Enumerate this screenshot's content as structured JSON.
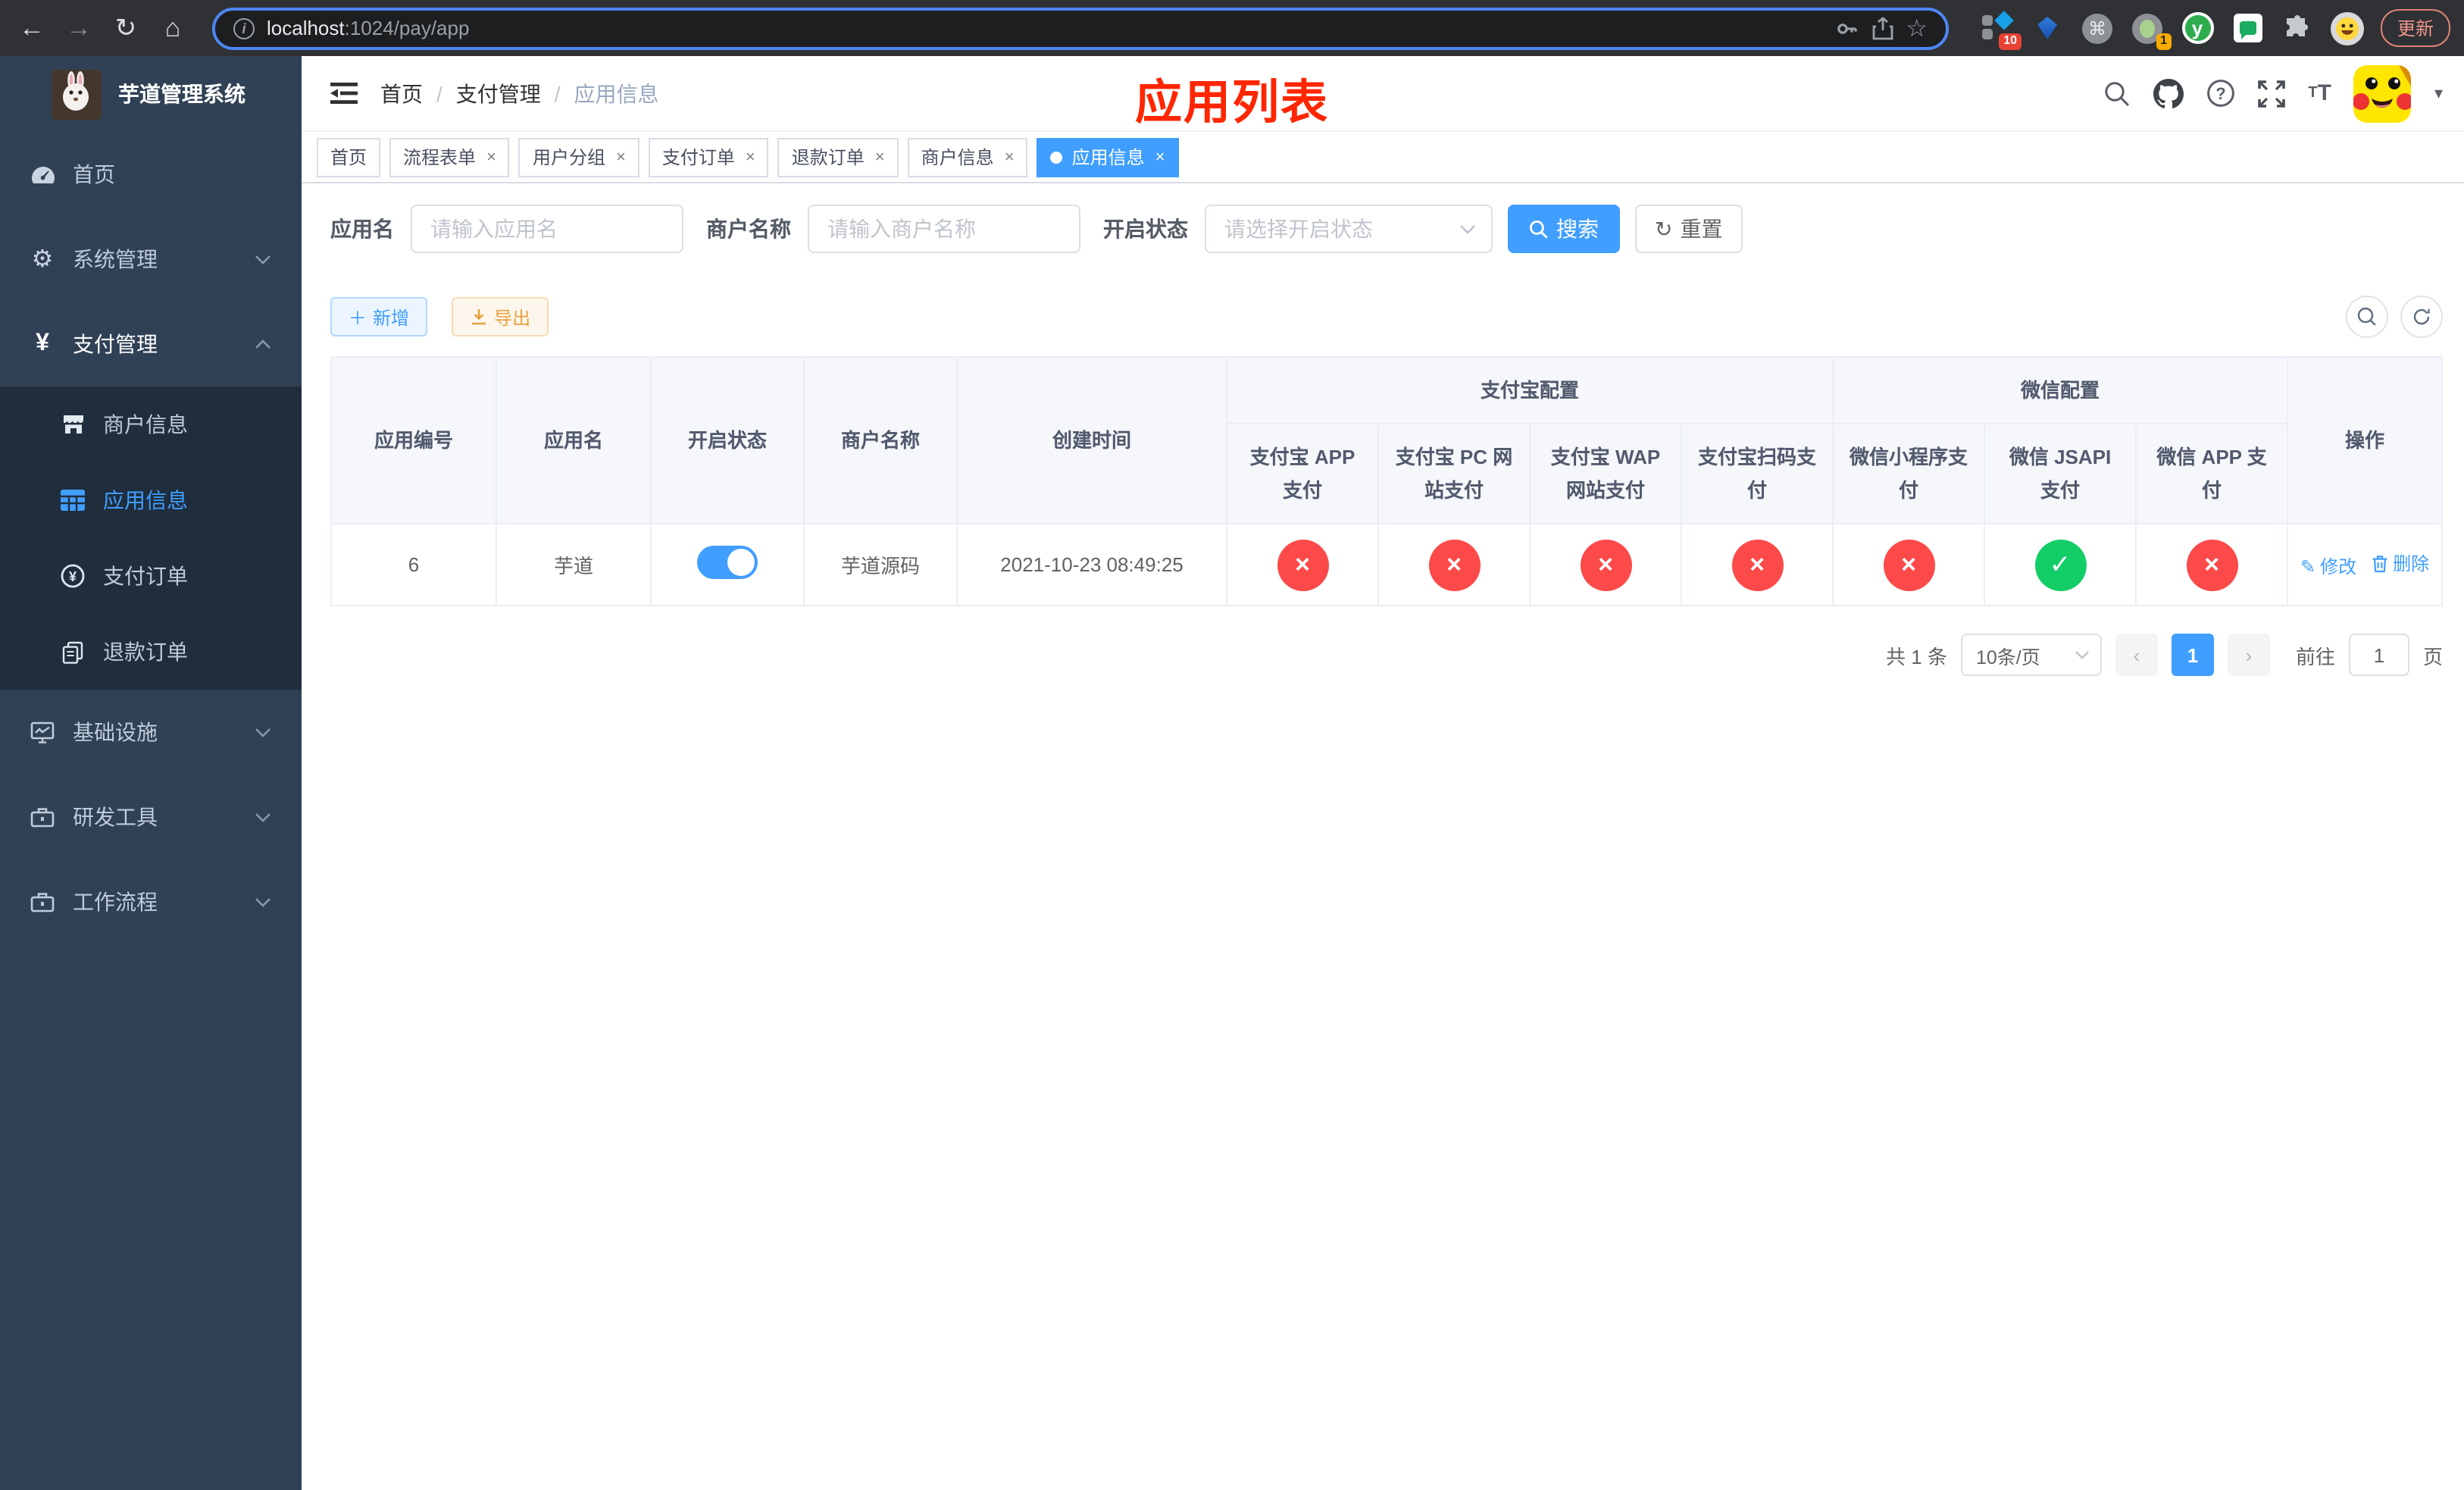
{
  "browser": {
    "url_host": "localhost",
    "url_path": ":1024/pay/app",
    "ext_badge_10": "10",
    "ext_badge_1": "1",
    "ext_y_label": "y",
    "update_button": "更新"
  },
  "sidebar": {
    "title": "芋道管理系统",
    "items": [
      {
        "label": "首页"
      },
      {
        "label": "系统管理"
      },
      {
        "label": "支付管理"
      },
      {
        "label": "基础设施"
      },
      {
        "label": "研发工具"
      },
      {
        "label": "工作流程"
      }
    ],
    "pay_submenu": [
      {
        "label": "商户信息"
      },
      {
        "label": "应用信息"
      },
      {
        "label": "支付订单"
      },
      {
        "label": "退款订单"
      }
    ]
  },
  "navbar": {
    "breadcrumb": [
      {
        "label": "首页"
      },
      {
        "label": "支付管理"
      },
      {
        "label": "应用信息"
      }
    ],
    "title_overlay": "应用列表"
  },
  "tags": [
    {
      "label": "首页"
    },
    {
      "label": "流程表单"
    },
    {
      "label": "用户分组"
    },
    {
      "label": "支付订单"
    },
    {
      "label": "退款订单"
    },
    {
      "label": "商户信息"
    },
    {
      "label": "应用信息"
    }
  ],
  "filters": {
    "app_name": {
      "label": "应用名",
      "placeholder": "请输入应用名"
    },
    "merchant_name": {
      "label": "商户名称",
      "placeholder": "请输入商户名称"
    },
    "status": {
      "label": "开启状态",
      "placeholder": "请选择开启状态"
    },
    "search_button": "搜索",
    "reset_button": "重置"
  },
  "toolbar": {
    "add_button": "新增",
    "export_button": "导出"
  },
  "table": {
    "columns": [
      "应用编号",
      "应用名",
      "开启状态",
      "商户名称",
      "创建时间",
      "操作"
    ],
    "groups": [
      {
        "label": "支付宝配置"
      },
      {
        "label": "微信配置"
      }
    ],
    "sub_columns": [
      "支付宝 APP 支付",
      "支付宝 PC 网站支付",
      "支付宝 WAP 网站支付",
      "支付宝扫码支付",
      "微信小程序支付",
      "微信 JSAPI 支付",
      "微信 APP 支付"
    ],
    "row": {
      "id": "6",
      "name": "芋道",
      "enabled": true,
      "merchant": "芋道源码",
      "created_at": "2021-10-23 08:49:25",
      "pay_configs": [
        "off",
        "off",
        "off",
        "off",
        "off",
        "on",
        "off"
      ],
      "edit_action": "修改",
      "delete_action": "删除"
    }
  },
  "pagination": {
    "total": "共 1 条",
    "page_size": "10条/页",
    "current_page": "1",
    "goto_label": "前往",
    "goto_value": "1",
    "goto_suffix": "页"
  },
  "colors": {
    "accent": "#409eff",
    "sidebar_bg": "#304156",
    "submenu_bg": "#1f2d3d",
    "danger": "#fb4a49",
    "success": "#13ce66",
    "title_red": "#ff2600"
  }
}
